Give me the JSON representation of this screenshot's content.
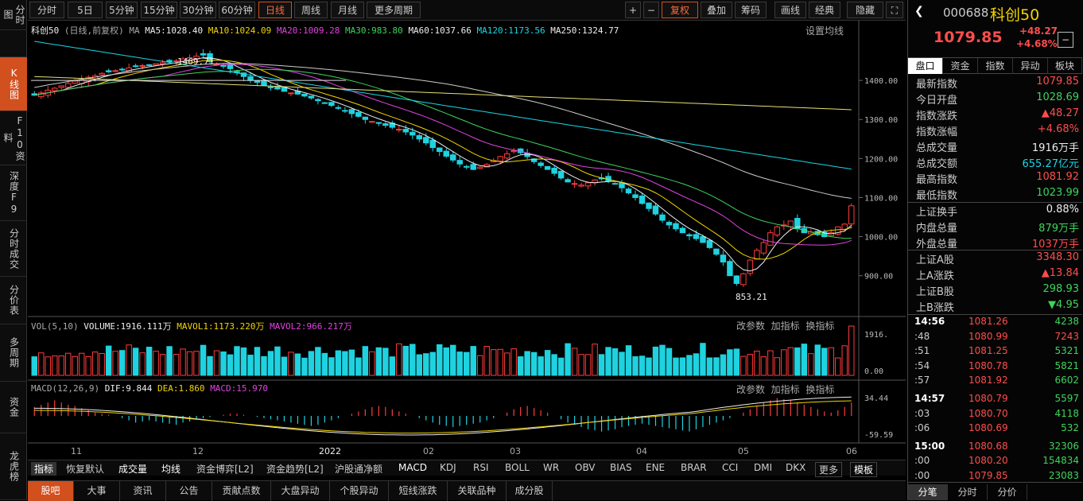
{
  "sidebar": {
    "tabs": [
      "分时图",
      "K线图",
      "F10资料",
      "深度F9",
      "分时成交",
      "分价表",
      "多周期",
      "资金",
      "龙虎榜"
    ]
  },
  "toolbar": {
    "periods": [
      "分时",
      "5日",
      "5分钟",
      "15分钟",
      "30分钟",
      "60分钟",
      "日线",
      "周线",
      "月线",
      "更多周期"
    ],
    "right": [
      "+",
      "−",
      "复权",
      "叠加",
      "筹码",
      "画线",
      "经典",
      "隐藏"
    ]
  },
  "chart": {
    "legend": {
      "name": "科创50",
      "mode": "(日线,前复权)",
      "ma_label": "MA",
      "ma5": "MA5:1028.40",
      "ma10": "MA10:1024.09",
      "ma20": "MA20:1009.28",
      "ma30": "MA30:983.80",
      "ma60": "MA60:1037.66",
      "ma120": "MA120:1173.56",
      "ma250": "MA250:1324.77",
      "settings": "设置均线"
    },
    "high_label": "1469.71",
    "low_label": "853.21",
    "vol_legend": {
      "label": "VOL(5,10)",
      "volume": "VOLUME:1916.111万",
      "mavol1": "MAVOL1:1173.220万",
      "mavol2": "MAVOL2:966.217万"
    },
    "macd_legend": {
      "label": "MACD(12,26,9)",
      "dif": "DIF:9.844",
      "dea": "DEA:1.860",
      "macd": "MACD:15.970"
    },
    "panel_buttons": [
      "改参数",
      "加指标",
      "换指标"
    ],
    "x_labels": [
      "11",
      "12",
      "2022",
      "02",
      "03",
      "04",
      "05",
      "06"
    ]
  },
  "chart_data": {
    "type": "candlestick",
    "price_axis": [
      1400,
      1300,
      1200,
      1100,
      1000,
      900
    ],
    "vol_axis": [
      "1916.",
      "0.00"
    ],
    "macd_axis": [
      "34.44",
      "-59.59"
    ],
    "close": [
      1362,
      1368,
      1375,
      1380,
      1386,
      1392,
      1398,
      1402,
      1408,
      1412,
      1418,
      1422,
      1425,
      1428,
      1432,
      1436,
      1438,
      1440,
      1443,
      1445,
      1448,
      1450,
      1455,
      1458,
      1462,
      1465,
      1448,
      1442,
      1438,
      1430,
      1420,
      1410,
      1400,
      1395,
      1388,
      1382,
      1378,
      1372,
      1368,
      1365,
      1360,
      1355,
      1348,
      1342,
      1336,
      1330,
      1322,
      1315,
      1308,
      1300,
      1295,
      1290,
      1285,
      1280,
      1275,
      1268,
      1260,
      1250,
      1240,
      1228,
      1218,
      1206,
      1196,
      1186,
      1178,
      1172,
      1178,
      1185,
      1195,
      1205,
      1212,
      1220,
      1215,
      1205,
      1192,
      1182,
      1172,
      1162,
      1150,
      1140,
      1136,
      1132,
      1138,
      1145,
      1148,
      1142,
      1135,
      1125,
      1112,
      1100,
      1085,
      1072,
      1058,
      1042,
      1030,
      1020,
      1010,
      1002,
      995,
      985,
      972,
      955,
      935,
      900,
      880,
      905,
      940,
      965,
      985,
      1010,
      1025,
      1030,
      1040,
      1020,
      1010,
      1012,
      1005,
      1000,
      1010,
      1025,
      1032,
      1079
    ]
  },
  "toolbar_right_extra": "⛶",
  "bottom": {
    "indicators": [
      "指标",
      "恢复默认",
      "成交量",
      "均线",
      "资金博弈[L2]",
      "资金趋势[L2]",
      "沪股通净额",
      "MACD",
      "KDJ",
      "RSI",
      "BOLL",
      "WR",
      "OBV",
      "BIAS",
      "ENE",
      "BRAR",
      "CCI",
      "DMI",
      "DKX",
      "更多",
      "模板"
    ]
  },
  "footer": {
    "tabs": [
      "股吧",
      "大事",
      "资讯",
      "公告",
      "贡献点数",
      "大盘异动",
      "个股异动",
      "短线涨跌",
      "关联品种",
      "成分股"
    ]
  },
  "quote": {
    "code": "000688",
    "name": "科创50",
    "price": "1079.85",
    "change": "+48.27",
    "pct": "+4.68%",
    "tabs": [
      "盘口",
      "资金",
      "指数",
      "异动",
      "板块"
    ],
    "rows": [
      {
        "k": "最新指数",
        "v": "1079.85",
        "c": "red"
      },
      {
        "k": "今日开盘",
        "v": "1028.69",
        "c": "green"
      },
      {
        "k": "指数涨跌",
        "v": "▲48.27",
        "c": "red"
      },
      {
        "k": "指数涨幅",
        "v": "+4.68%",
        "c": "red"
      },
      {
        "k": "总成交量",
        "v": "1916万手",
        "c": "white"
      },
      {
        "k": "总成交额",
        "v": "655.27亿元",
        "c": "cyan"
      },
      {
        "k": "最高指数",
        "v": "1081.92",
        "c": "red"
      },
      {
        "k": "最低指数",
        "v": "1023.99",
        "c": "green"
      }
    ],
    "rows2": [
      {
        "k": "上证换手",
        "v": "0.88%",
        "c": "white"
      },
      {
        "k": "内盘总量",
        "v": "879万手",
        "c": "green"
      },
      {
        "k": "外盘总量",
        "v": "1037万手",
        "c": "red"
      }
    ],
    "rows3": [
      {
        "k": "上证A股",
        "v": "3348.30",
        "c": "red"
      },
      {
        "k": "上A涨跌",
        "v": "▲13.84",
        "c": "red"
      },
      {
        "k": "上证B股",
        "v": "298.93",
        "c": "green"
      },
      {
        "k": "上B涨跌",
        "v": "▼4.95",
        "c": "green"
      }
    ],
    "ticks": [
      {
        "t": "14:56",
        "p": "1081.26",
        "q": "4238",
        "bold": true
      },
      {
        "t": ":48",
        "p": "1080.99",
        "q": "7243"
      },
      {
        "t": ":51",
        "p": "1081.25",
        "q": "5321"
      },
      {
        "t": ":54",
        "p": "1080.78",
        "q": "5821"
      },
      {
        "t": ":57",
        "p": "1081.92",
        "q": "6602"
      },
      {
        "t": "14:57",
        "p": "1080.79",
        "q": "5597",
        "bold": true
      },
      {
        "t": ":03",
        "p": "1080.70",
        "q": "4118"
      },
      {
        "t": ":06",
        "p": "1080.69",
        "q": "532"
      },
      {
        "t": "15:00",
        "p": "1080.68",
        "q": "32306",
        "bold": true
      },
      {
        "t": ":00",
        "p": "1080.20",
        "q": "154834"
      },
      {
        "t": ":00",
        "p": "1079.85",
        "q": "23083"
      }
    ],
    "bottom_tabs": [
      "分笔",
      "分时",
      "分价"
    ]
  }
}
